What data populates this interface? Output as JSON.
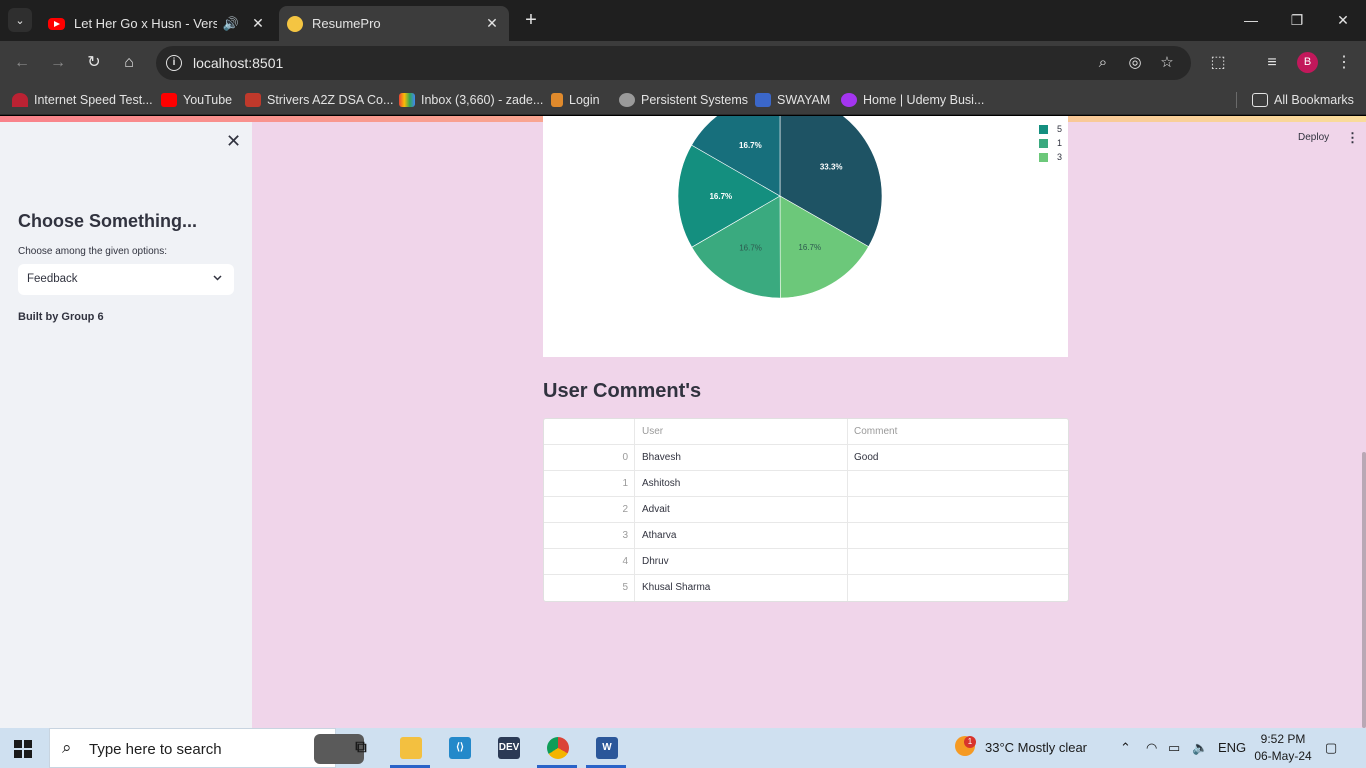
{
  "browser": {
    "tabs": [
      {
        "title": "Let Her Go x Husn - Version",
        "favicon": "youtube-icon",
        "audio": true
      },
      {
        "title": "ResumePro",
        "favicon": "streamlit-icon",
        "active": true
      }
    ],
    "url": "localhost:8501",
    "profile_initial": "B",
    "bookmarks": [
      {
        "label": "Internet Speed Test..."
      },
      {
        "label": "YouTube"
      },
      {
        "label": "Strivers A2Z DSA Co..."
      },
      {
        "label": "Inbox (3,660) - zade..."
      },
      {
        "label": "Login"
      },
      {
        "label": "Persistent Systems"
      },
      {
        "label": "SWAYAM"
      },
      {
        "label": "Home | Udemy Busi..."
      }
    ],
    "all_bookmarks": "All Bookmarks"
  },
  "sidebar": {
    "close_glyph": "✕",
    "title": "Choose Something...",
    "select_label": "Choose among the given options:",
    "select_value": "Feedback",
    "footer": "Built by Group 6"
  },
  "header": {
    "deploy_label": "Deploy",
    "menu_glyph": "⋮"
  },
  "chart_data": {
    "type": "pie",
    "slices": [
      {
        "label": "5",
        "value": 33.3,
        "text": "33.3%",
        "color": "#1e5364"
      },
      {
        "label": "1",
        "value": 16.7,
        "text": "16.7%",
        "color": "#6cc87a"
      },
      {
        "label": "3",
        "value": 16.7,
        "text": "16.7%",
        "color": "#3aaa7f"
      },
      {
        "label": "",
        "value": 16.7,
        "text": "16.7%",
        "color": "#148f7f"
      },
      {
        "label": "",
        "value": 16.7,
        "text": "16.7%",
        "color": "#176f7c"
      }
    ],
    "legend": [
      {
        "label": "5",
        "color": "#148f7f"
      },
      {
        "label": "1",
        "color": "#3aaa7f"
      },
      {
        "label": "3",
        "color": "#6cc87a"
      }
    ]
  },
  "comments": {
    "title": "User Comment's",
    "columns": [
      "",
      "User",
      "Comment"
    ],
    "rows": [
      {
        "idx": "0",
        "user": "Bhavesh",
        "comment": "Good"
      },
      {
        "idx": "1",
        "user": "Ashitosh",
        "comment": ""
      },
      {
        "idx": "2",
        "user": "Advait",
        "comment": ""
      },
      {
        "idx": "3",
        "user": "Atharva",
        "comment": ""
      },
      {
        "idx": "4",
        "user": "Dhruv",
        "comment": ""
      },
      {
        "idx": "5",
        "user": "Khusal Sharma",
        "comment": ""
      }
    ]
  },
  "taskbar": {
    "search_placeholder": "Type here to search",
    "weather": "33°C  Mostly clear",
    "weather_badge": "1",
    "language": "ENG",
    "time": "9:52 PM",
    "date": "06-May-24"
  }
}
